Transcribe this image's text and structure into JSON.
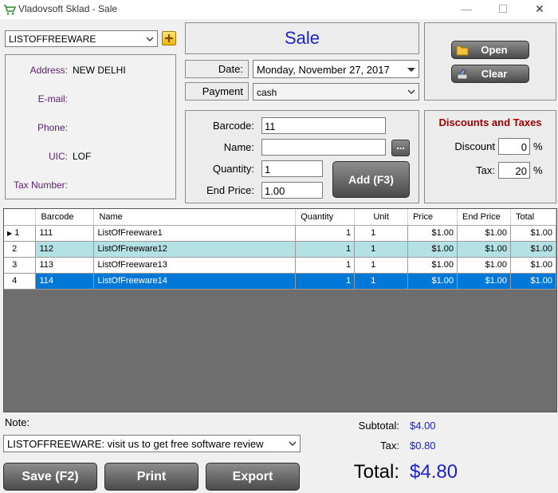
{
  "window": {
    "title": "Vladovsoft Sklad - Sale",
    "min": "—",
    "max": "☐",
    "close": "✕"
  },
  "customer": {
    "selected": "LISTOFFREEWARE",
    "address_label": "Address:",
    "address": "NEW DELHI",
    "email_label": "E-mail:",
    "email": "",
    "phone_label": "Phone:",
    "phone": "",
    "uic_label": "UIC:",
    "uic": "LOF",
    "tax_label": "Tax Number:",
    "tax_number": ""
  },
  "header": {
    "title": "Sale"
  },
  "date": {
    "label": "Date:",
    "value": "Monday, November 27, 2017"
  },
  "payment": {
    "label": "Payment",
    "value": "cash"
  },
  "entry": {
    "barcode_label": "Barcode:",
    "barcode": "11",
    "name_label": "Name:",
    "name": "",
    "browse": "...",
    "quantity_label": "Quantity:",
    "quantity": "1",
    "end_price_label": "End Price:",
    "end_price": "1.00",
    "add_label": "Add (F3)"
  },
  "actions": {
    "open": "Open",
    "clear": "Clear"
  },
  "discounts": {
    "title": "Discounts and Taxes",
    "discount_label": "Discount",
    "discount": "0",
    "discount_unit": "%",
    "tax_label": "Tax:",
    "tax": "20",
    "tax_unit": "%"
  },
  "grid": {
    "columns": [
      "Barcode",
      "Name",
      "Quantity",
      "Unit",
      "Price",
      "End Price",
      "Total"
    ],
    "rows": [
      {
        "n": "1",
        "marker": "▶",
        "barcode": "111",
        "name": "ListOfFreeware1",
        "qty": "1",
        "unit": "1",
        "price": "$1.00",
        "end": "$1.00",
        "total": "$1.00"
      },
      {
        "n": "2",
        "marker": "",
        "barcode": "112",
        "name": "ListOfFreeware12",
        "qty": "1",
        "unit": "1",
        "price": "$1.00",
        "end": "$1.00",
        "total": "$1.00"
      },
      {
        "n": "3",
        "marker": "",
        "barcode": "113",
        "name": "ListOfFreeware13",
        "qty": "1",
        "unit": "1",
        "price": "$1.00",
        "end": "$1.00",
        "total": "$1.00"
      },
      {
        "n": "4",
        "marker": "",
        "barcode": "114",
        "name": "ListOfFreeware14",
        "qty": "1",
        "unit": "1",
        "price": "$1.00",
        "end": "$1.00",
        "total": "$1.00"
      }
    ]
  },
  "note": {
    "label": "Note:",
    "value": "LISTOFFREEWARE: visit us to get free software review"
  },
  "totals": {
    "subtotal_label": "Subtotal:",
    "subtotal": "$4.00",
    "tax_label": "Tax:",
    "tax": "$0.80",
    "total_label": "Total:",
    "total": "$4.80"
  },
  "bottom_buttons": {
    "save": "Save (F2)",
    "print": "Print",
    "export": "Export"
  },
  "colors": {
    "accent_blue": "#1c23c8",
    "label_purple": "#5a1e6e",
    "section_red": "#a00000",
    "selected_row": "#0078d7",
    "alt_row": "#b3e1e4"
  }
}
